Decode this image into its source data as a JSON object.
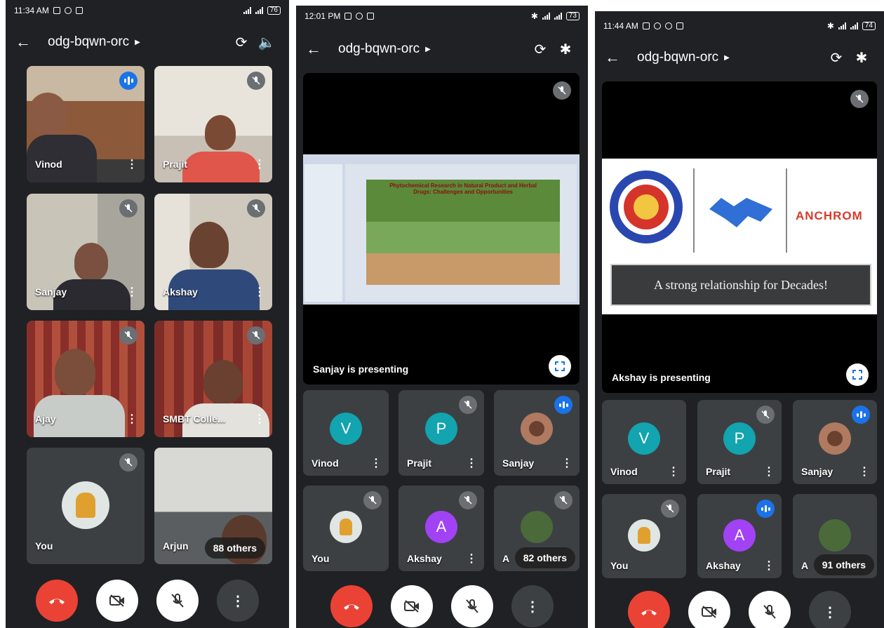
{
  "meeting_code": "odg-bqwn-orc",
  "phone1": {
    "time": "11:34 AM",
    "battery": "76",
    "tiles": [
      {
        "name": "Vinod"
      },
      {
        "name": "Prajit"
      },
      {
        "name": "Sanjay"
      },
      {
        "name": "Akshay"
      },
      {
        "name": "Ajay"
      },
      {
        "name": "SMBT Colle..."
      },
      {
        "name": "You"
      },
      {
        "name": "Arjun"
      }
    ],
    "others": "88 others"
  },
  "phone2": {
    "time": "12:01 PM",
    "battery": "73",
    "presenting": "Sanjay is presenting",
    "slide_title": "Phytochemical Research in Natural Product and Herbal Drugs: Challenges and Opportunities",
    "tiles": [
      {
        "name": "Vinod",
        "initial": "V"
      },
      {
        "name": "Prajit",
        "initial": "P"
      },
      {
        "name": "Sanjay"
      },
      {
        "name": "You"
      },
      {
        "name": "Akshay",
        "initial": "A"
      },
      {
        "name": "A"
      }
    ],
    "others": "82 others"
  },
  "phone3": {
    "time": "11:44 AM",
    "battery": "74",
    "presenting": "Akshay is presenting",
    "brand_text": "ANCHROM",
    "tagline": "A strong relationship for Decades!",
    "tiles": [
      {
        "name": "Vinod",
        "initial": "V"
      },
      {
        "name": "Prajit",
        "initial": "P"
      },
      {
        "name": "Sanjay"
      },
      {
        "name": "You"
      },
      {
        "name": "Akshay",
        "initial": "A"
      },
      {
        "name": "A"
      }
    ],
    "others": "91 others"
  },
  "colors": {
    "background": "#202124",
    "tile": "#3c4043",
    "end_call": "#ea4335",
    "teal_avatar": "#12a4af",
    "purple_avatar": "#a142f4",
    "speaking": "#1a73e8"
  }
}
